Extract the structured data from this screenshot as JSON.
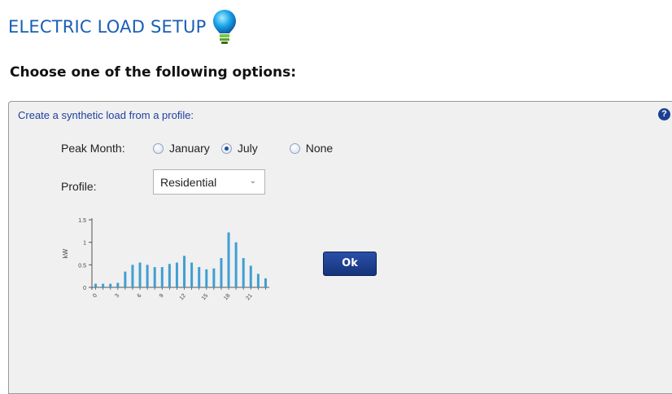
{
  "header": {
    "title": "ELECTRIC LOAD SETUP",
    "icon": "lightbulb-icon",
    "subtitle": "Choose one of the following options:"
  },
  "panel": {
    "heading": "Create a synthetic load from a profile:",
    "help_label": "?",
    "peak_month": {
      "label": "Peak Month:",
      "options": [
        "January",
        "July",
        "None"
      ],
      "selected": "July"
    },
    "profile": {
      "label": "Profile:",
      "value": "Residential"
    },
    "ok_label": "Ok"
  },
  "colors": {
    "title": "#1a5fb4",
    "heading": "#1f3fa0",
    "bars": "#3f9fd3",
    "ok_button": "#1d3f91"
  },
  "chart_data": {
    "type": "bar",
    "ylabel": "kW",
    "ylim": [
      0,
      1.5
    ],
    "yticks": [
      "0",
      "0.5",
      "1",
      "1.5"
    ],
    "xticks": [
      "0",
      "3",
      "6",
      "9",
      "12",
      "15",
      "18",
      "21"
    ],
    "categories": [
      0,
      1,
      2,
      3,
      4,
      5,
      6,
      7,
      8,
      9,
      10,
      11,
      12,
      13,
      14,
      15,
      16,
      17,
      18,
      19,
      20,
      21,
      22,
      23
    ],
    "values": [
      0.08,
      0.08,
      0.08,
      0.1,
      0.35,
      0.5,
      0.55,
      0.5,
      0.45,
      0.45,
      0.52,
      0.55,
      0.7,
      0.55,
      0.45,
      0.4,
      0.42,
      0.65,
      1.22,
      1.0,
      0.65,
      0.48,
      0.3,
      0.2
    ]
  }
}
